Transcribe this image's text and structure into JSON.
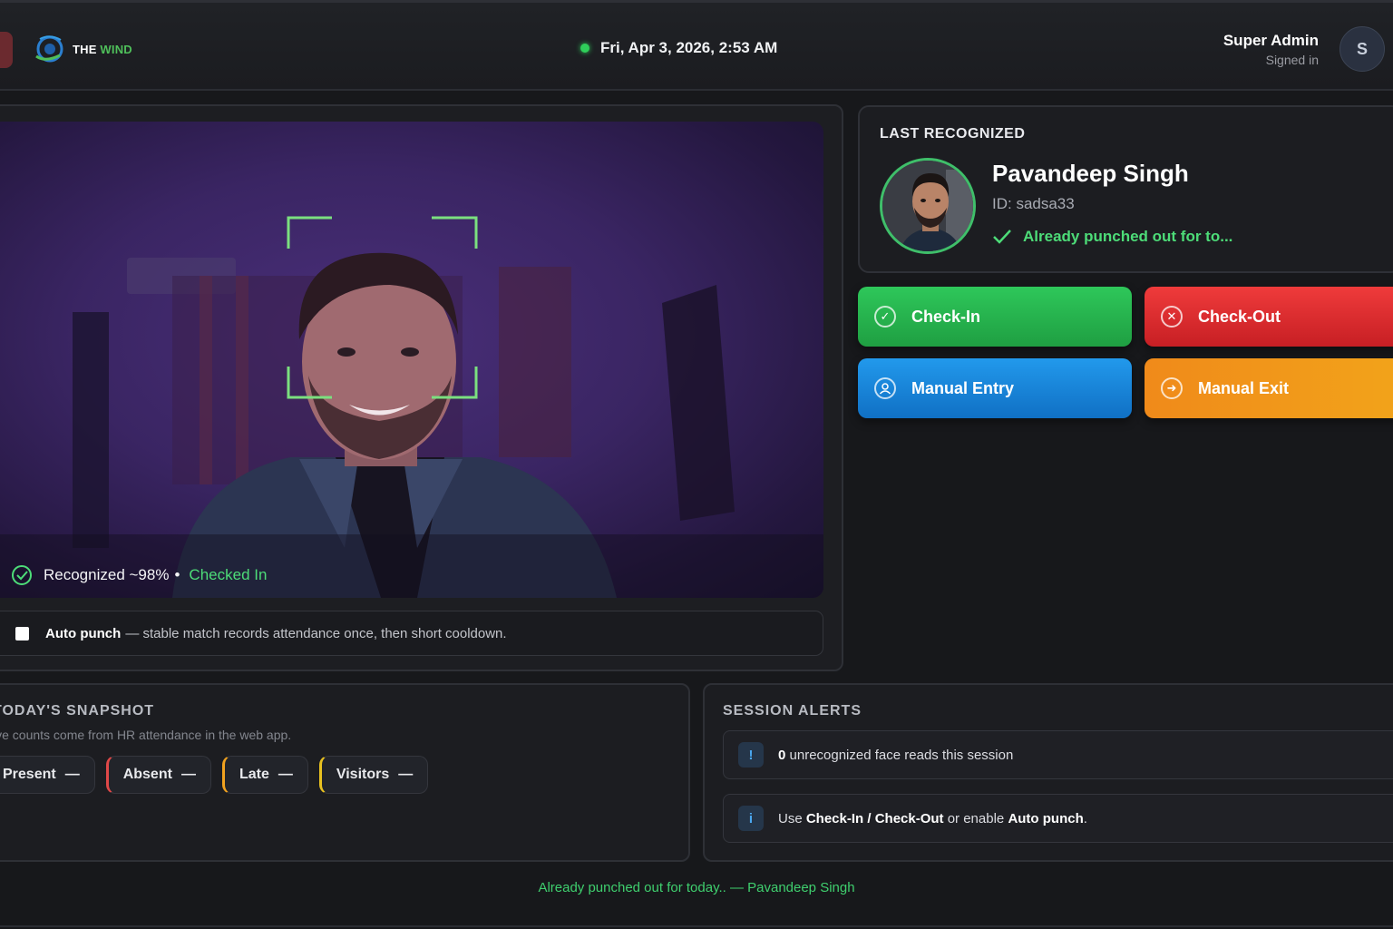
{
  "header": {
    "logo_text_main": "THE ",
    "logo_text_accent": "WIND",
    "datetime": "Fri, Apr 3, 2026, 2:53 AM",
    "user_name": "Super Admin",
    "user_status": "Signed in",
    "avatar_initial": "S"
  },
  "camera": {
    "recognized_text": "Recognized ~98%",
    "separator": "•",
    "checked_status": "Checked In",
    "status_color": "#4ddc78"
  },
  "auto_punch": {
    "label": "Auto punch",
    "description": "— stable match records attendance once, then short cooldown."
  },
  "last_recognized": {
    "title": "LAST RECOGNIZED",
    "name": "Pavandeep Singh",
    "id": "ID: sadsa33",
    "status": "Already punched out for to..."
  },
  "actions": {
    "check_in": "Check-In",
    "check_out": "Check-Out",
    "manual_entry": "Manual Entry",
    "manual_exit": "Manual Exit"
  },
  "snapshot": {
    "title": "TODAY'S SNAPSHOT",
    "subtitle": "ive counts come from HR attendance in the web app.",
    "chips": [
      {
        "label": "Present",
        "value": "—"
      },
      {
        "label": "Absent",
        "value": "—"
      },
      {
        "label": "Late",
        "value": "—"
      },
      {
        "label": "Visitors",
        "value": "—"
      }
    ]
  },
  "alerts": {
    "title": "SESSION ALERTS",
    "items": [
      {
        "badge": "!",
        "count": "0",
        "text": " unrecognized face reads this session"
      },
      {
        "badge": "i",
        "pre": "Use ",
        "bold1": "Check-In / Check-Out",
        "mid": " or enable ",
        "bold2": "Auto punch",
        "post": "."
      }
    ]
  },
  "footer": {
    "message": "Already punched out for today.. — Pavandeep Singh"
  },
  "colors": {
    "accent_green": "#2ec75a",
    "accent_red": "#ef3b3b",
    "accent_blue": "#2299ec",
    "accent_orange": "#f08a1a"
  }
}
